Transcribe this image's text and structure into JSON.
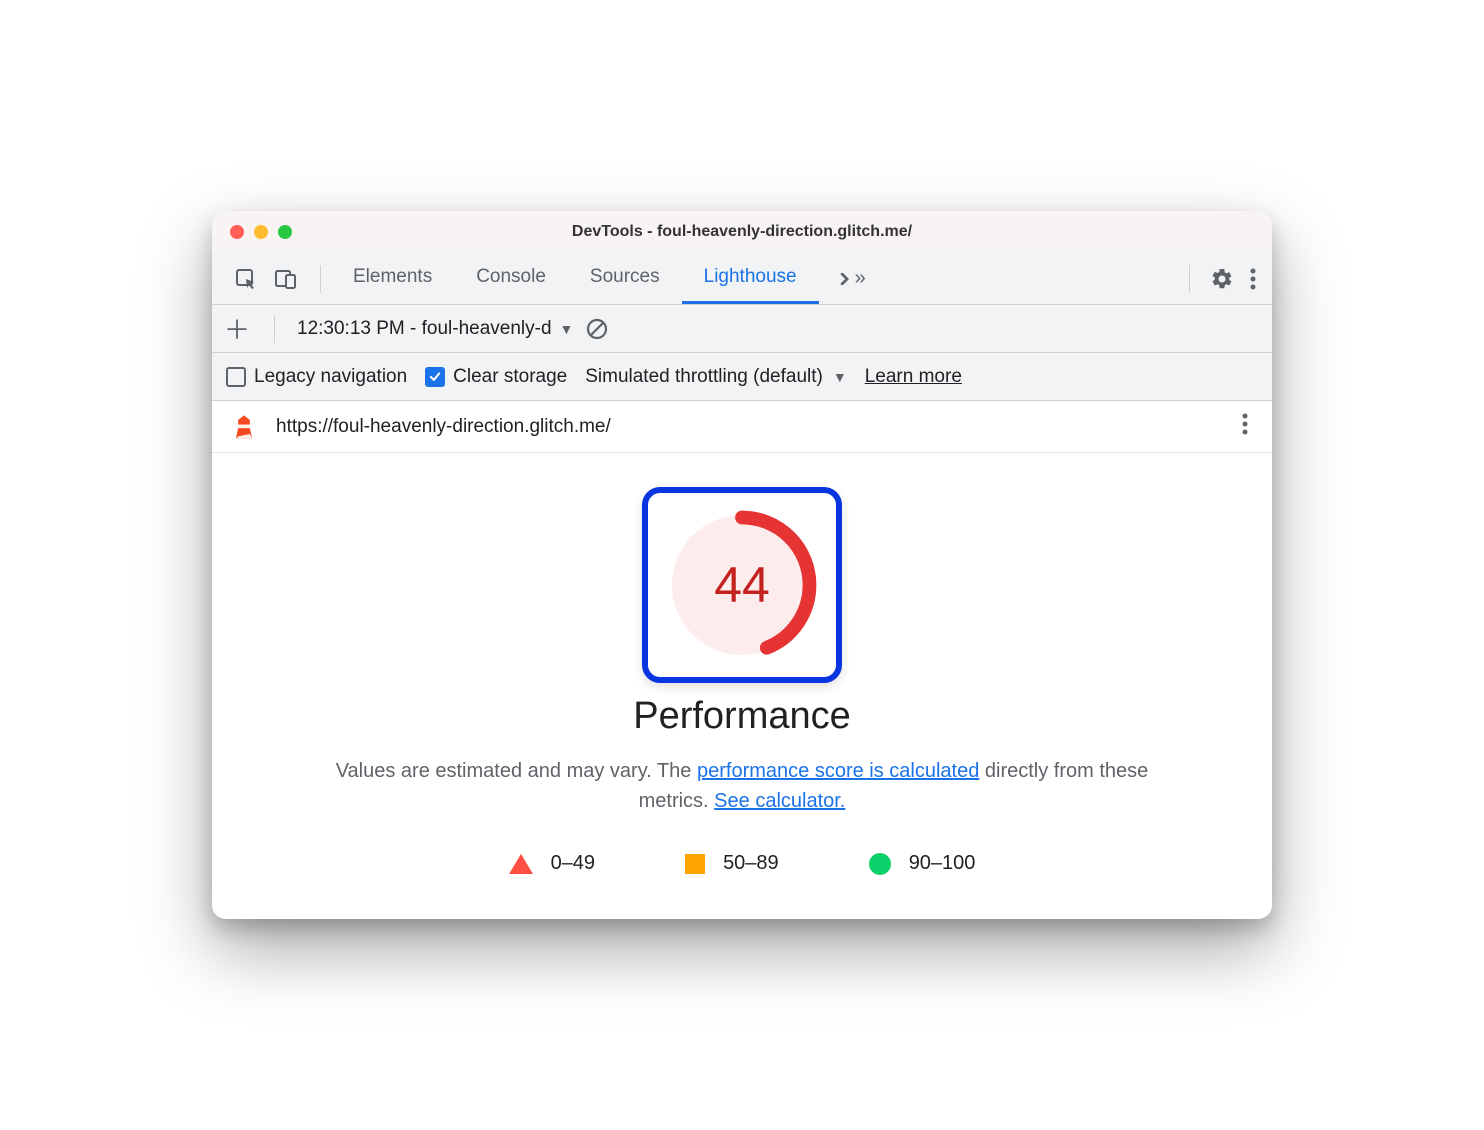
{
  "window": {
    "title": "DevTools - foul-heavenly-direction.glitch.me/"
  },
  "tabs": {
    "items": [
      "Elements",
      "Console",
      "Sources",
      "Lighthouse"
    ],
    "active": "Lighthouse"
  },
  "sub1": {
    "report_label": "12:30:13 PM - foul-heavenly-d"
  },
  "sub2": {
    "legacy_label": "Legacy navigation",
    "clear_label": "Clear storage",
    "throttling_label": "Simulated throttling (default)",
    "learn_more": "Learn more"
  },
  "url_row": {
    "url": "https://foul-heavenly-direction.glitch.me/"
  },
  "report": {
    "score": 44,
    "category": "Performance",
    "desc_prefix": "Values are estimated and may vary. The ",
    "link1": "performance score is calculated",
    "desc_mid": " directly from these metrics. ",
    "link2": "See calculator.",
    "legend": {
      "fail": "0–49",
      "avg": "50–89",
      "pass": "90–100"
    }
  },
  "chart_data": {
    "type": "gauge",
    "title": "Performance",
    "value": 44,
    "min": 0,
    "max": 100,
    "thresholds": [
      {
        "range": "0–49",
        "color": "#ff4e42",
        "label": "fail"
      },
      {
        "range": "50–89",
        "color": "#ffa400",
        "label": "average"
      },
      {
        "range": "90–100",
        "color": "#0cce6b",
        "label": "pass"
      }
    ]
  }
}
